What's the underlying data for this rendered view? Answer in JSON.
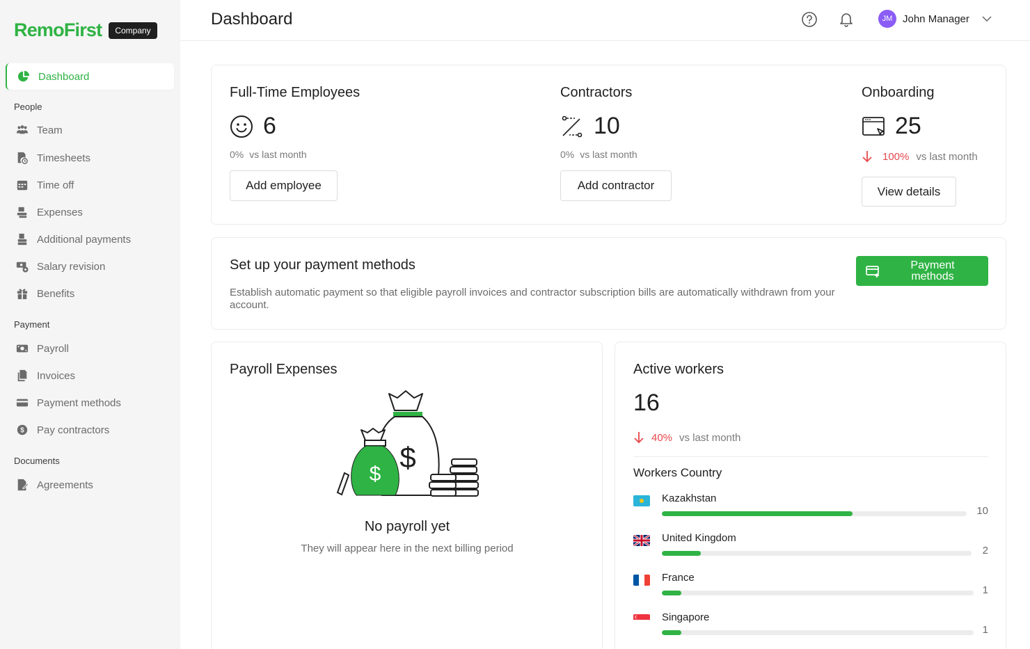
{
  "brand": {
    "name": "RemoFirst",
    "badge": "Company"
  },
  "header": {
    "title": "Dashboard",
    "user_initials": "JM",
    "user_name": "John Manager"
  },
  "sidebar": {
    "active": "Dashboard",
    "sections": {
      "people": "People",
      "payment": "Payment",
      "documents": "Documents"
    },
    "items": {
      "team": "Team",
      "timesheets": "Timesheets",
      "time_off": "Time off",
      "expenses": "Expenses",
      "additional_payments": "Additional payments",
      "salary_revision": "Salary revision",
      "benefits": "Benefits",
      "payroll": "Payroll",
      "invoices": "Invoices",
      "payment_methods": "Payment methods",
      "pay_contractors": "Pay contractors",
      "agreements": "Agreements"
    }
  },
  "stats": {
    "employees": {
      "title": "Full-Time Employees",
      "value": "6",
      "pct": "0%",
      "vs": "vs last month",
      "button": "Add employee"
    },
    "contractors": {
      "title": "Contractors",
      "value": "10",
      "pct": "0%",
      "vs": "vs last month",
      "button": "Add contractor"
    },
    "onboarding": {
      "title": "Onboarding",
      "value": "25",
      "pct": "100%",
      "vs": "vs last month",
      "button": "View details"
    }
  },
  "payment_setup": {
    "title": "Set up your payment methods",
    "description": "Establish automatic payment so that eligible payroll invoices and contractor subscription bills are automatically withdrawn from your account.",
    "button": "Payment methods"
  },
  "payroll_expenses": {
    "title": "Payroll Expenses",
    "empty_title": "No payroll yet",
    "empty_subtitle": "They will appear here in the next billing period"
  },
  "active_workers": {
    "title": "Active workers",
    "value": "16",
    "pct": "40%",
    "vs": "vs last month",
    "countries_title": "Workers Country",
    "countries": [
      {
        "name": "Kazakhstan",
        "count": "10",
        "share": 0.625
      },
      {
        "name": "United Kingdom",
        "count": "2",
        "share": 0.125
      },
      {
        "name": "France",
        "count": "1",
        "share": 0.0625
      },
      {
        "name": "Singapore",
        "count": "1",
        "share": 0.0625
      }
    ]
  },
  "colors": {
    "brand_green": "#2fb344",
    "negative_red": "#e5484d",
    "avatar_purple": "#8b5cf6"
  }
}
